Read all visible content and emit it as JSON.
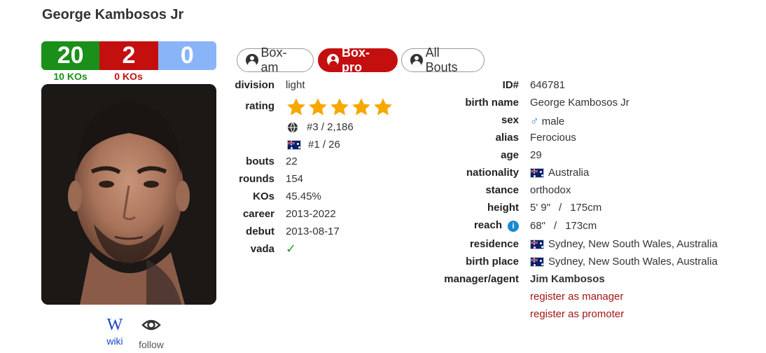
{
  "boxer": {
    "name": "George Kambosos Jr"
  },
  "record": {
    "wins": "20",
    "losses": "2",
    "draws": "0",
    "wins_kos": "10 KOs",
    "losses_kos": "0 KOs",
    "colors": {
      "wins": "#1a8f1a",
      "losses": "#c40f0f",
      "draws": "#8ab4f8"
    }
  },
  "links": {
    "wiki_label": "wiki",
    "wiki_logo": "W",
    "follow_label": "follow"
  },
  "tabs": [
    {
      "label": "Box-am",
      "active": false,
      "icon": "user-circle-icon"
    },
    {
      "label": "Box-pro",
      "active": true,
      "icon": "user-circle-icon"
    },
    {
      "label": "All Bouts",
      "active": false,
      "icon": "user-circle-icon"
    }
  ],
  "stats": {
    "division_label": "division",
    "division": "light",
    "rating_label": "rating",
    "rating_stars": 5,
    "world_rank": "#3 / 2,186",
    "country_rank": "#1 / 26",
    "bouts_label": "bouts",
    "bouts": "22",
    "rounds_label": "rounds",
    "rounds": "154",
    "kos_label": "KOs",
    "kos": "45.45%",
    "career_label": "career",
    "career": "2013-2022",
    "debut_label": "debut",
    "debut": "2013-08-17",
    "vada_label": "vada",
    "vada": "✓"
  },
  "bio": {
    "id_label": "ID#",
    "id": "646781",
    "birth_name_label": "birth name",
    "birth_name": "George Kambosos Jr",
    "sex_label": "sex",
    "sex_symbol": "♂",
    "sex": "male",
    "alias_label": "alias",
    "alias": "Ferocious",
    "age_label": "age",
    "age": "29",
    "nationality_label": "nationality",
    "nationality": "Australia",
    "stance_label": "stance",
    "stance": "orthodox",
    "height_label": "height",
    "height_imperial": "5' 9\"",
    "height_metric": "175cm",
    "reach_label": "reach",
    "reach_info": "i",
    "reach_imperial": "68\"",
    "reach_metric": "173cm",
    "sep": "/",
    "residence_label": "residence",
    "residence": "Sydney, New South Wales, Australia",
    "birth_place_label": "birth place",
    "birth_place": "Sydney, New South Wales, Australia",
    "manager_label": "manager/agent",
    "manager": "Jim Kambosos",
    "register_manager": "register as manager",
    "register_promoter": "register as promoter"
  }
}
